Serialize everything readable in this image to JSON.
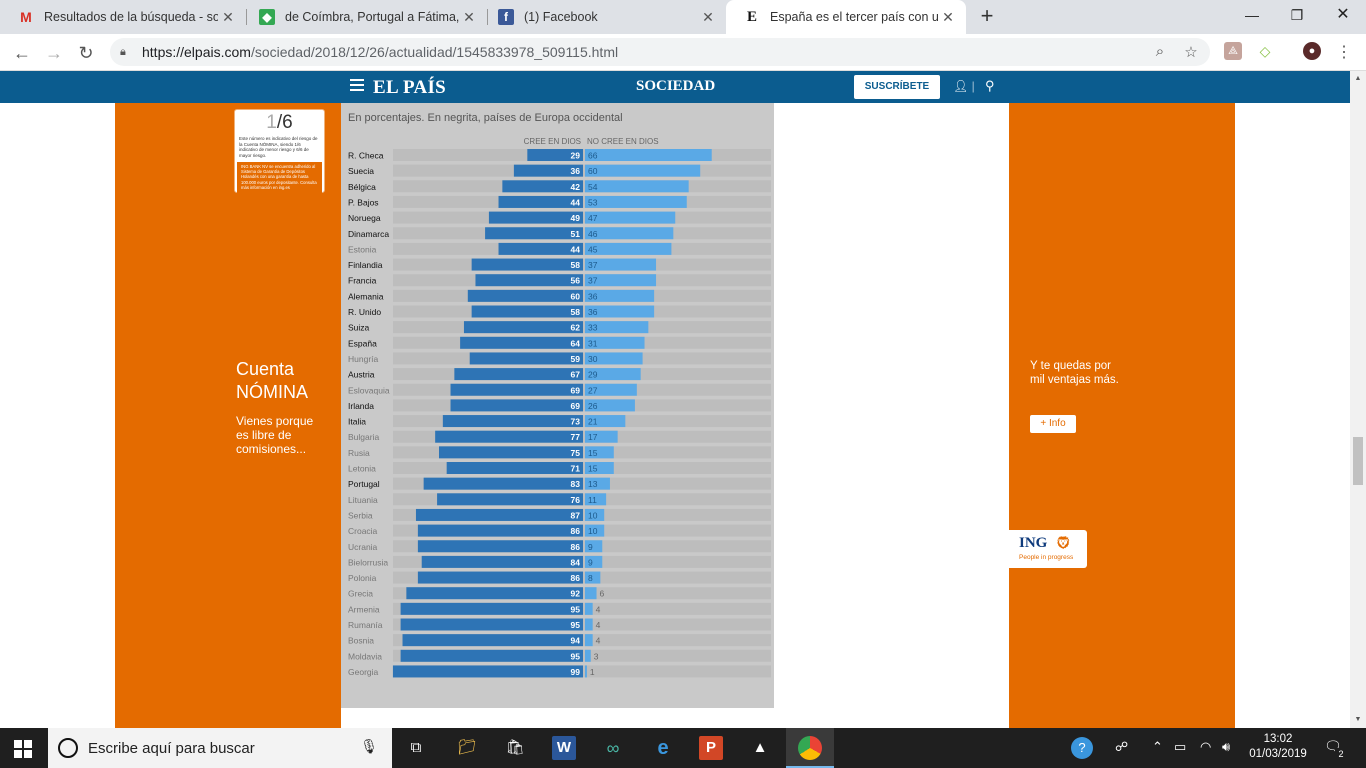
{
  "browser": {
    "tabs": [
      {
        "label": "Resultados de la búsqueda - soyj",
        "icon": "gmail-icon"
      },
      {
        "label": "de Coímbra, Portugal a Fátima, P",
        "icon": "maps-icon"
      },
      {
        "label": "(1) Facebook",
        "icon": "facebook-icon"
      },
      {
        "label": "España es el tercer país con un m",
        "icon": "elpais-icon"
      }
    ],
    "url_host": "https://elpais.com",
    "url_path": "/sociedad/2018/12/26/actualidad/1545833978_509115.html"
  },
  "site": {
    "logo": "EL PAÍS",
    "section": "SOCIEDAD",
    "subscribe": "SUSCRÍBETE"
  },
  "ad_left": {
    "risk_num": "1",
    "risk_total": "/6",
    "risk_text": "Este número es indicativo del riesgo de la Cuenta NÓMINA, siendo 1/6 indicativo de menor riesgo y 6/6 de mayor riesgo.",
    "risk_text2": "ING BANK NV se encuentra adherido al Sistema de Garantía de Depósitos Holandés con una garantía de hasta 100.000 euros por depositante. Consulta más información en ing.es",
    "title_line1": "Cuenta",
    "title_line2": "NÓMINA",
    "subtitle": "Vienes porque es libre de comisiones..."
  },
  "ad_right": {
    "text": "Y te quedas por mil ventajas más.",
    "button": "+ Info",
    "brand": "ING",
    "tagline": "People in progress"
  },
  "chart_data": {
    "type": "bar",
    "subtitle": "En porcentajes. En negrita, países de Europa occidental",
    "series": [
      {
        "name": "CREE EN DIOS",
        "color": "#2e74b5",
        "values": [
          29,
          36,
          42,
          44,
          49,
          51,
          44,
          58,
          56,
          60,
          58,
          62,
          64,
          59,
          67,
          69,
          69,
          73,
          77,
          75,
          71,
          83,
          76,
          87,
          86,
          86,
          84,
          86,
          92,
          95,
          95,
          94,
          95,
          99
        ]
      },
      {
        "name": "NO CREE EN DIOS",
        "color": "#5aa9e6",
        "values": [
          66,
          60,
          54,
          53,
          47,
          46,
          45,
          37,
          37,
          36,
          36,
          33,
          31,
          30,
          29,
          27,
          26,
          21,
          17,
          15,
          15,
          13,
          11,
          10,
          10,
          9,
          9,
          8,
          6,
          4,
          4,
          4,
          3,
          1
        ]
      }
    ],
    "categories": [
      "R. Checa",
      "Suecia",
      "Bélgica",
      "P. Bajos",
      "Noruega",
      "Dinamarca",
      "Estonia",
      "Finlandia",
      "Francia",
      "Alemania",
      "R. Unido",
      "Suiza",
      "España",
      "Hungría",
      "Austria",
      "Eslovaquia",
      "Irlanda",
      "Italia",
      "Bulgaria",
      "Rusia",
      "Letonia",
      "Portugal",
      "Lituania",
      "Serbia",
      "Croacia",
      "Ucrania",
      "Bielorrusia",
      "Polonia",
      "Grecia",
      "Armenia",
      "Rumanía",
      "Bosnia",
      "Moldavia",
      "Georgia"
    ],
    "western": [
      true,
      true,
      true,
      true,
      true,
      true,
      false,
      true,
      true,
      true,
      true,
      true,
      true,
      false,
      true,
      false,
      true,
      true,
      false,
      false,
      false,
      true,
      false,
      false,
      false,
      false,
      false,
      false,
      false,
      false,
      false,
      false,
      false,
      false
    ],
    "xlim": [
      0,
      100
    ]
  },
  "taskbar": {
    "search_placeholder": "Escribe aquí para buscar",
    "time": "13:02",
    "date": "01/03/2019",
    "notifications": "2"
  }
}
